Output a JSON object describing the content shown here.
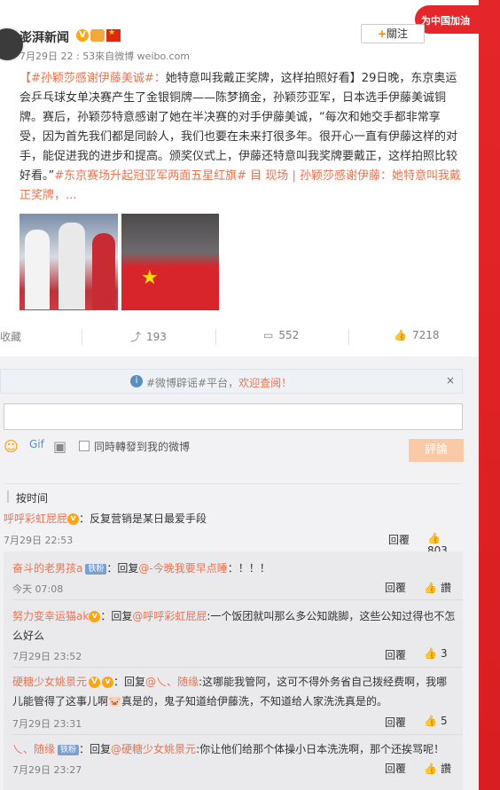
{
  "post": {
    "username": "澎湃新闻",
    "v_badge": "V",
    "follow_label": "關注",
    "follow_plus": "+",
    "meta": "7月29日 22 : 53來自微博 weibo.com",
    "text_tag": "【#孙颖莎感谢伊藤美诚#：",
    "text_1": "她特意叫我戴正奖牌，这样拍照好看】29日晚，东京奥运会乒乓球女单决赛产生了金银铜牌——陈梦摘金，孙颖莎亚军，日本选手伊藤美诚铜牌。赛后，孙颖莎特意感谢了她在半决赛的对手伊藤美诚，“每次和她交手都非常享受，因为首先我们都是同龄人，我们也要在未来打很多年。很开心一直有伊藤这样的对手，能促进我的进步和提高。颁奖仪式上，伊藤还特意叫我奖牌要戴正，这样拍照比较好看。”",
    "text_tag2": "#东京赛场升起冠亚军两面五星红旗#",
    "text_link": " 目 现场 | 孙颖莎感谢伊藤：她特意叫我戴正奖牌，..."
  },
  "banner": {
    "text": "为中国加油"
  },
  "actions": {
    "collect": "收藏",
    "repost": "193",
    "comment": "552",
    "like": "7218"
  },
  "notice": {
    "text": "#微博辟谣#平台，",
    "highlight": "欢迎查阅！",
    "close": "×"
  },
  "composer": {
    "repost_label": "同時轉發到我的微博",
    "submit_label": "評論"
  },
  "sort_label": "按时间",
  "comments": {
    "root": {
      "user": "呼呼彩虹屁屁",
      "text": "：反复营销是某日最爱手段",
      "time": "7月29日 22:53",
      "reply": "回覆",
      "likes": "803"
    },
    "subs": [
      {
        "user": "奋斗的老男孩a",
        "badge": "铁粉",
        "text": "：回复",
        "mention": "@-今晚我要早点睡",
        "text2": "：！！！",
        "time": "今天 07:08",
        "reply": "回覆",
        "likes": "讚"
      },
      {
        "user": "努力变幸运猫ak",
        "text": "：回复",
        "mention": "@呼呼彩虹屁屁",
        "text2": ":一个饭团就叫那么多公知跳脚，这些公知过得也不怎么好么",
        "time": "7月29日 23:52",
        "reply": "回覆",
        "likes": "3"
      },
      {
        "user": "硬糖少女姚景元",
        "text": "：回复",
        "mention": "@乀、随缘",
        "text2": ":这哪能我管阿，这可不得外务省自己拨经费啊，我哪儿能管得了这事儿啊🐷真是的，鬼子知道给伊藤洗，不知道给人家洗洗真是的。",
        "time": "7月29日 23:31",
        "reply": "回覆",
        "likes": "5"
      },
      {
        "user": "乀、随缘",
        "badge": "铁粉",
        "text": "：回复",
        "mention": "@硬糖少女姚景元",
        "text2": ":你让他们给那个体操小日本洗洗啊，那个还挨骂呢！",
        "time": "7月29日 23:27",
        "reply": "回覆",
        "likes": "讚"
      }
    ]
  }
}
